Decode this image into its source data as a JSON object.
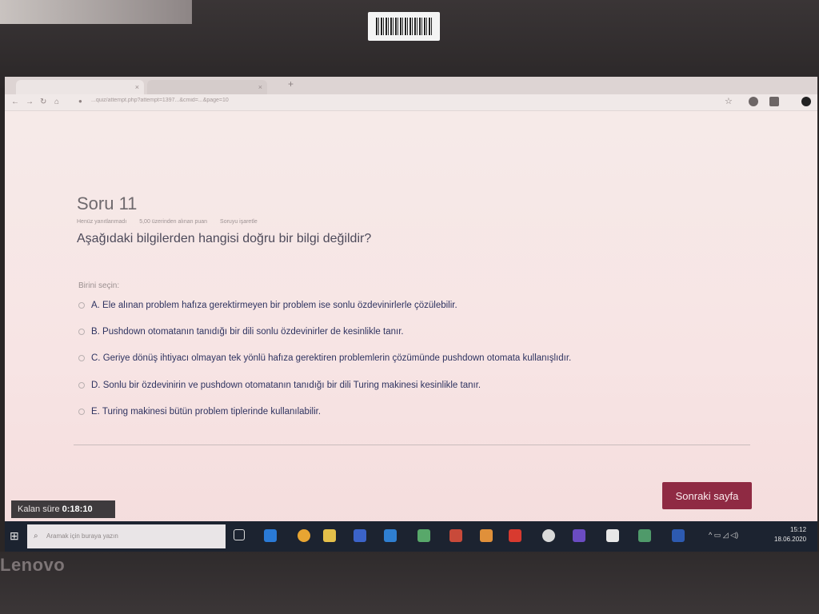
{
  "question": {
    "title": "Soru 11",
    "meta": [
      "Henüz yanıtlanmadı",
      "5,00 üzerinden alınan puan",
      "Soruyu işaretle"
    ],
    "text": "Aşağıdaki bilgilerden hangisi doğru bir bilgi değildir?",
    "choose_label": "Birini seçin:",
    "options": [
      "A. Ele alınan problem hafıza gerektirmeyen bir problem ise sonlu özdevinirlerle çözülebilir.",
      "B. Pushdown otomatanın tanıdığı bir dili sonlu özdevinirler de kesinlikle tanır.",
      "C. Geriye dönüş ihtiyacı olmayan tek yönlü hafıza gerektiren problemlerin çözümünde pushdown otomata kullanışlıdır.",
      "D. Sonlu bir özdevinirin ve pushdown otomatanın tanıdığı bir dili Turing makinesi kesinlikle tanır.",
      "E. Turing makinesi bütün problem tiplerinde kullanılabilir."
    ]
  },
  "next_button": "Sonraki sayfa",
  "timer": {
    "label": "Kalan süre",
    "value": "0:18:10"
  },
  "browser": {
    "url": "...quiz/attempt.php?attempt=1397...&cmid=...&page=10"
  },
  "taskbar": {
    "search_placeholder": "Aramak için buraya yazın",
    "time": "15:12",
    "date": "18.06.2020"
  },
  "device": {
    "brand": "Lenovo"
  },
  "colors": {
    "accent": "#8f2a43",
    "page_bg": "#f7e4e4",
    "question_text": "#4d4a5a",
    "option_text": "#2e3360"
  }
}
